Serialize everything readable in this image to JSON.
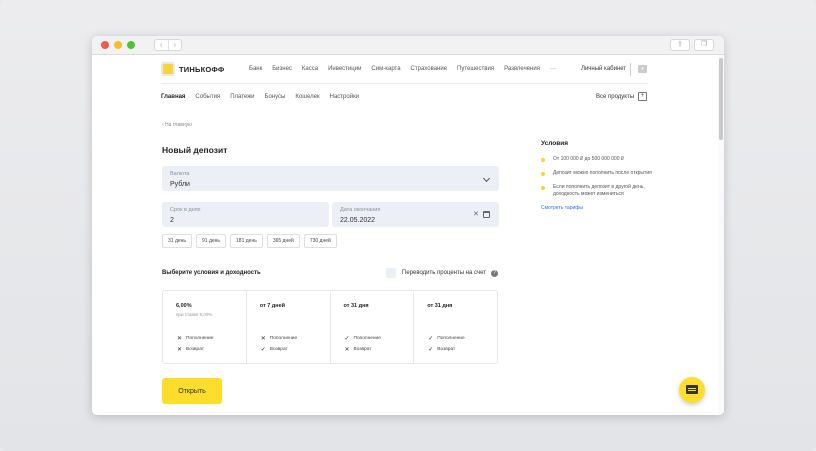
{
  "browser": {
    "back": "‹",
    "forward": "›",
    "share": "⇪",
    "tabs": "❐"
  },
  "header": {
    "logo_text": "ТИНЬКОФФ",
    "nav": [
      "Банк",
      "Бизнес",
      "Касса",
      "Инвестиции",
      "Сим-карта",
      "Страхование",
      "Путешествия",
      "Развлечения",
      "···"
    ],
    "account_label": "Личный кабинет"
  },
  "subnav": {
    "items": [
      "Главная",
      "События",
      "Платежи",
      "Бонусы",
      "Кошелек",
      "Настройки"
    ],
    "active_index": 0,
    "all_products": "Все продукты"
  },
  "page": {
    "back_link": "‹ На главную",
    "title": "Новый депозит"
  },
  "currency": {
    "label": "Валюта",
    "value": "Рубли"
  },
  "term": {
    "label": "Срок в днях",
    "value": "2"
  },
  "end_date": {
    "label": "Дата окончания",
    "value": "22.05.2022",
    "clear": "✕"
  },
  "chips": [
    "31 день",
    "91 день",
    "181 день",
    "365 дней",
    "730 дней"
  ],
  "conditions": {
    "title": "Выберите условия и доходность",
    "transfer_label": "Переводить проценты на счет",
    "help": "?",
    "cards": [
      {
        "title": "6,00%",
        "subtitle": "при ставке 6,00%",
        "rows": [
          {
            "mark": "✕",
            "label": "Пополнение"
          },
          {
            "mark": "✕",
            "label": "Возврат"
          }
        ]
      },
      {
        "title": "от 7 дней",
        "subtitle": "",
        "rows": [
          {
            "mark": "✕",
            "label": "Пополнение"
          },
          {
            "mark": "✓",
            "label": "Возврат"
          }
        ]
      },
      {
        "title": "от 31 дня",
        "subtitle": "",
        "rows": [
          {
            "mark": "✓",
            "label": "Пополнение"
          },
          {
            "mark": "✕",
            "label": "Возврат"
          }
        ]
      },
      {
        "title": "от 31 дня",
        "subtitle": "",
        "rows": [
          {
            "mark": "✓",
            "label": "Пополнение"
          },
          {
            "mark": "✓",
            "label": "Возврат"
          }
        ]
      }
    ]
  },
  "open_button": "Открыть",
  "aside": {
    "title": "Условия",
    "items": [
      "От 100 000 ₽ до 500 000 000 ₽",
      "Депозит можно пополнить после открытия",
      "Если пополнить депозит в другой день, доходность может измениться"
    ],
    "link": "Смотреть тарифы"
  },
  "colors": {
    "accent": "#ffdd2d",
    "link": "#336fee",
    "field_bg": "#eceff5"
  }
}
